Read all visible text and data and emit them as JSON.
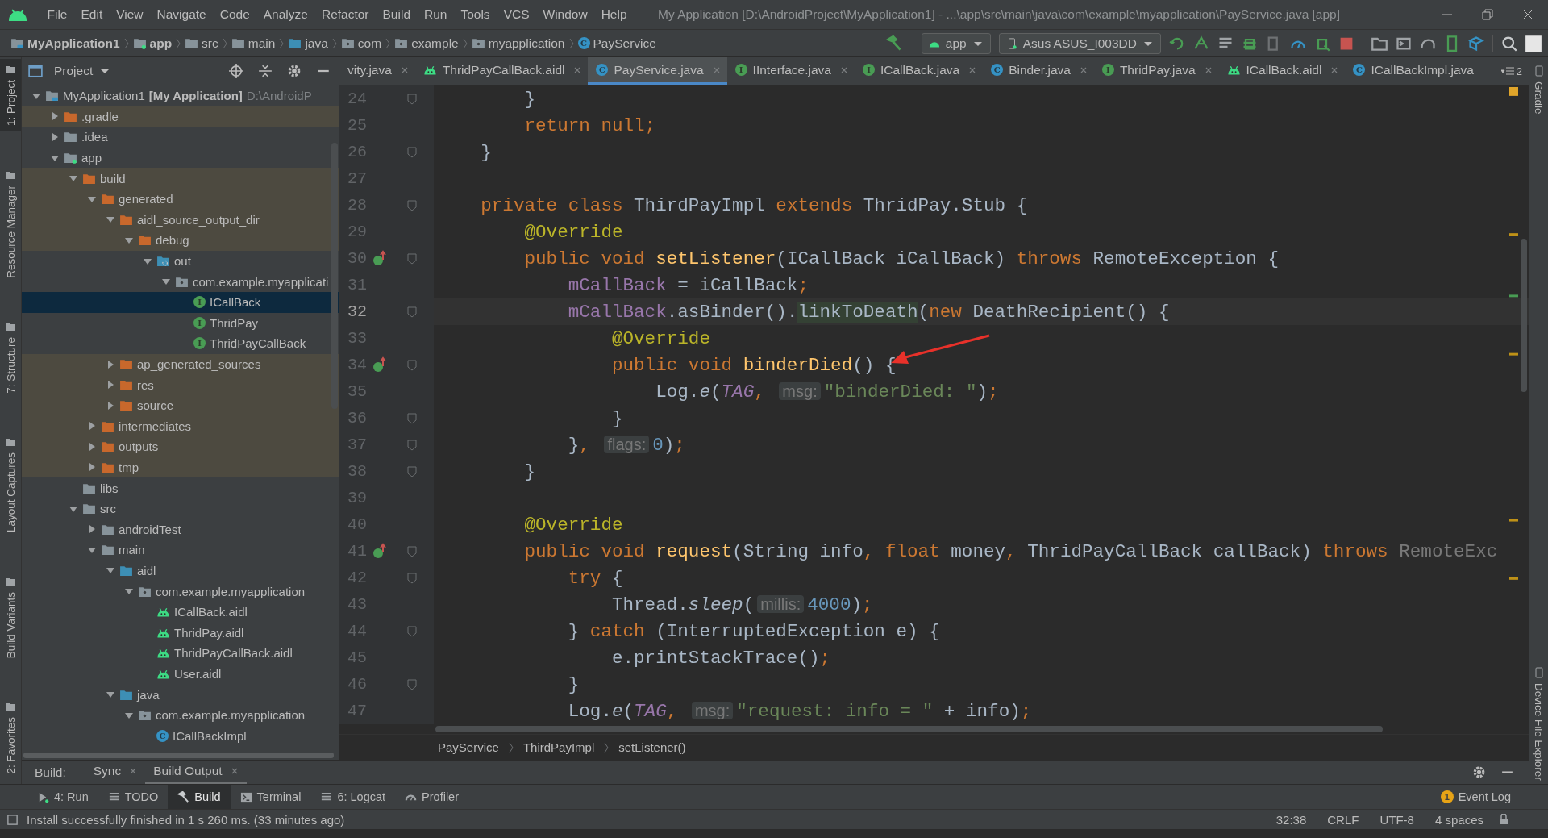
{
  "menu_bar": {
    "items": [
      "File",
      "Edit",
      "View",
      "Navigate",
      "Code",
      "Analyze",
      "Refactor",
      "Build",
      "Run",
      "Tools",
      "VCS",
      "Window",
      "Help"
    ],
    "title": "My Application [D:\\AndroidProject\\MyApplication1] - ...\\app\\src\\main\\java\\com\\example\\myapplication\\PayService.java [app]"
  },
  "navigation_bar": {
    "crumbs": [
      {
        "label": "MyApplication1",
        "kind": "project",
        "bold": true
      },
      {
        "label": "app",
        "kind": "module",
        "bold": true
      },
      {
        "label": "src",
        "kind": "folder",
        "bold": false
      },
      {
        "label": "main",
        "kind": "folder",
        "bold": false
      },
      {
        "label": "java",
        "kind": "folder-source",
        "bold": false
      },
      {
        "label": "com",
        "kind": "package",
        "bold": false
      },
      {
        "label": "example",
        "kind": "package",
        "bold": false
      },
      {
        "label": "myapplication",
        "kind": "package",
        "bold": false
      },
      {
        "label": "PayService",
        "kind": "class",
        "badge": "C",
        "bold": false
      }
    ],
    "run_config": "app",
    "device": "Asus ASUS_I003DD"
  },
  "left_stripe": [
    {
      "label": "1: Project",
      "selected": true
    },
    {
      "label": "Resource Manager",
      "selected": false
    },
    {
      "label": "7: Structure",
      "selected": false
    },
    {
      "label": "Layout Captures",
      "selected": false
    },
    {
      "label": "Build Variants",
      "selected": false
    },
    {
      "label": "2: Favorites",
      "selected": false
    }
  ],
  "project_panel": {
    "title": "Project",
    "tree": [
      {
        "label": "MyApplication1",
        "module": "[My Application]",
        "path": "D:\\AndroidP",
        "kind": "project",
        "expanded": true,
        "excluded": false,
        "selected": false,
        "children": [
          {
            "label": ".gradle",
            "kind": "folder-excluded",
            "expanded": false,
            "excluded": true,
            "selected": false
          },
          {
            "label": ".idea",
            "kind": "folder",
            "expanded": false,
            "excluded": false,
            "selected": false
          },
          {
            "label": "app",
            "kind": "module",
            "expanded": true,
            "excluded": false,
            "selected": false,
            "children": [
              {
                "label": "build",
                "kind": "folder-excluded",
                "expanded": true,
                "excluded": true,
                "selected": false,
                "children": [
                  {
                    "label": "generated",
                    "kind": "folder-excluded",
                    "expanded": true,
                    "excluded": true,
                    "selected": false,
                    "children": [
                      {
                        "label": "aidl_source_output_dir",
                        "kind": "folder-excluded",
                        "expanded": true,
                        "excluded": true,
                        "selected": false,
                        "children": [
                          {
                            "label": "debug",
                            "kind": "folder-excluded",
                            "expanded": true,
                            "excluded": true,
                            "selected": false,
                            "children": [
                              {
                                "label": "out",
                                "kind": "generated",
                                "expanded": true,
                                "excluded": false,
                                "selected": false,
                                "children": [
                                  {
                                    "label": "com.example.myapplicati",
                                    "kind": "package",
                                    "expanded": true,
                                    "excluded": false,
                                    "selected": false,
                                    "children": [
                                      {
                                        "label": "ICallBack",
                                        "kind": "interface",
                                        "badge": "I",
                                        "excluded": false,
                                        "selected": true
                                      },
                                      {
                                        "label": "ThridPay",
                                        "kind": "interface",
                                        "badge": "I",
                                        "excluded": false,
                                        "selected": false
                                      },
                                      {
                                        "label": "ThridPayCallBack",
                                        "kind": "interface",
                                        "badge": "I",
                                        "excluded": false,
                                        "selected": false
                                      }
                                    ]
                                  }
                                ]
                              }
                            ]
                          }
                        ]
                      },
                      {
                        "label": "ap_generated_sources",
                        "kind": "folder-excluded",
                        "expanded": false,
                        "excluded": true,
                        "selected": false
                      },
                      {
                        "label": "res",
                        "kind": "folder-excluded",
                        "expanded": false,
                        "excluded": true,
                        "selected": false
                      },
                      {
                        "label": "source",
                        "kind": "folder-excluded",
                        "expanded": false,
                        "excluded": true,
                        "selected": false
                      }
                    ]
                  },
                  {
                    "label": "intermediates",
                    "kind": "folder-excluded",
                    "expanded": false,
                    "excluded": true,
                    "selected": false
                  },
                  {
                    "label": "outputs",
                    "kind": "folder-excluded",
                    "expanded": false,
                    "excluded": true,
                    "selected": false
                  },
                  {
                    "label": "tmp",
                    "kind": "folder-excluded",
                    "expanded": false,
                    "excluded": true,
                    "selected": false
                  }
                ]
              },
              {
                "label": "libs",
                "kind": "folder",
                "excluded": false,
                "selected": false
              },
              {
                "label": "src",
                "kind": "folder",
                "expanded": true,
                "excluded": false,
                "selected": false,
                "children": [
                  {
                    "label": "androidTest",
                    "kind": "folder",
                    "expanded": false,
                    "excluded": false,
                    "selected": false
                  },
                  {
                    "label": "main",
                    "kind": "folder",
                    "expanded": true,
                    "excluded": false,
                    "selected": false,
                    "children": [
                      {
                        "label": "aidl",
                        "kind": "folder-source",
                        "expanded": true,
                        "excluded": false,
                        "selected": false,
                        "children": [
                          {
                            "label": "com.example.myapplication",
                            "kind": "package",
                            "expanded": true,
                            "excluded": false,
                            "selected": false,
                            "children": [
                              {
                                "label": "ICallBack.aidl",
                                "kind": "aidl",
                                "excluded": false,
                                "selected": false
                              },
                              {
                                "label": "ThridPay.aidl",
                                "kind": "aidl",
                                "excluded": false,
                                "selected": false
                              },
                              {
                                "label": "ThridPayCallBack.aidl",
                                "kind": "aidl",
                                "excluded": false,
                                "selected": false
                              },
                              {
                                "label": "User.aidl",
                                "kind": "aidl",
                                "excluded": false,
                                "selected": false
                              }
                            ]
                          }
                        ]
                      },
                      {
                        "label": "java",
                        "kind": "folder-source",
                        "expanded": true,
                        "excluded": false,
                        "selected": false,
                        "children": [
                          {
                            "label": "com.example.myapplication",
                            "kind": "package",
                            "expanded": true,
                            "excluded": false,
                            "selected": false,
                            "children": [
                              {
                                "label": "ICallBackImpl",
                                "kind": "class",
                                "badge": "C",
                                "excluded": false,
                                "selected": false
                              }
                            ]
                          }
                        ]
                      }
                    ]
                  }
                ]
              }
            ]
          }
        ]
      }
    ]
  },
  "editor_tabs": {
    "tabs": [
      {
        "label": "vity.java",
        "selected": false,
        "closable": true
      },
      {
        "label": "ThridPayCallBack.aidl",
        "kind": "aidl",
        "selected": false,
        "closable": true
      },
      {
        "label": "PayService.java",
        "kind": "class",
        "badge": "C",
        "selected": true,
        "closable": true
      },
      {
        "label": "IInterface.java",
        "kind": "interface",
        "badge": "I",
        "selected": false,
        "closable": true
      },
      {
        "label": "ICallBack.java",
        "kind": "interface",
        "badge": "I",
        "selected": false,
        "closable": true
      },
      {
        "label": "Binder.java",
        "kind": "class",
        "badge": "C",
        "selected": false,
        "closable": true
      },
      {
        "label": "ThridPay.java",
        "kind": "interface",
        "badge": "I",
        "selected": false,
        "closable": true
      },
      {
        "label": "ICallBack.aidl",
        "kind": "aidl",
        "selected": false,
        "closable": true
      },
      {
        "label": "ICallBackImpl.java",
        "kind": "class",
        "badge": "C",
        "selected": false,
        "closable": false
      }
    ],
    "overflow_count": "2"
  },
  "editor": {
    "lines": [
      {
        "number": "24",
        "current": false,
        "fold": true,
        "override": false,
        "tokens": [
          {
            "kind": "plain",
            "text": "        }"
          }
        ]
      },
      {
        "number": "25",
        "current": false,
        "fold": false,
        "override": false,
        "tokens": [
          {
            "kind": "keyword",
            "text": "        return null;"
          }
        ]
      },
      {
        "number": "26",
        "current": false,
        "fold": true,
        "override": false,
        "tokens": [
          {
            "kind": "plain",
            "text": "    }"
          }
        ]
      },
      {
        "number": "27",
        "current": false,
        "fold": false,
        "override": false
      },
      {
        "number": "28",
        "current": false,
        "fold": true,
        "override": false,
        "tokens": [
          {
            "kind": "keyword",
            "text": "    private class"
          },
          {
            "kind": "plain",
            "text": " ThirdPayImpl "
          },
          {
            "kind": "keyword",
            "text": "extends"
          },
          {
            "kind": "plain",
            "text": " ThridPay.Stub {"
          }
        ]
      },
      {
        "number": "29",
        "current": false,
        "fold": false,
        "override": false,
        "tokens": [
          {
            "kind": "annotation",
            "text": "        @Override"
          }
        ]
      },
      {
        "number": "30",
        "current": false,
        "fold": true,
        "override": true,
        "tokens": [
          {
            "kind": "keyword",
            "text": "        public void "
          },
          {
            "kind": "method",
            "text": "setListener"
          },
          {
            "kind": "plain",
            "text": "(ICallBack iCallBack) "
          },
          {
            "kind": "keyword",
            "text": "throws"
          },
          {
            "kind": "plain",
            "text": " RemoteException {"
          }
        ]
      },
      {
        "number": "31",
        "current": false,
        "fold": false,
        "override": false,
        "tokens": [
          {
            "kind": "field",
            "text": "            mCallBack"
          },
          {
            "kind": "plain",
            "text": " = iCallBack"
          },
          {
            "kind": "keyword",
            "text": ";"
          }
        ]
      },
      {
        "number": "32",
        "current": true,
        "fold": true,
        "override": false,
        "tokens": [
          {
            "kind": "field",
            "text": "            mCallBack"
          },
          {
            "kind": "plain",
            "text": ".asBinder()."
          },
          {
            "kind": "highlight",
            "text": "linkToDeath"
          },
          {
            "kind": "plain",
            "text": "("
          },
          {
            "kind": "keyword",
            "text": "new"
          },
          {
            "kind": "plain",
            "text": " DeathRecipient() {"
          }
        ]
      },
      {
        "number": "33",
        "current": false,
        "fold": false,
        "override": false,
        "tokens": [
          {
            "kind": "annotation",
            "text": "                @Override"
          }
        ]
      },
      {
        "number": "34",
        "current": false,
        "fold": true,
        "override": true,
        "tokens": [
          {
            "kind": "keyword",
            "text": "                public void "
          },
          {
            "kind": "method",
            "text": "binderDied"
          },
          {
            "kind": "plain",
            "text": "() {"
          }
        ]
      },
      {
        "number": "35",
        "current": false,
        "fold": false,
        "override": false,
        "tokens": [
          {
            "kind": "plain",
            "text": "                    Log."
          },
          {
            "kind": "italic",
            "text": "e"
          },
          {
            "kind": "plain",
            "text": "("
          },
          {
            "kind": "static",
            "text": "TAG"
          },
          {
            "kind": "keyword",
            "text": ", "
          },
          {
            "kind": "hint",
            "text": "msg:"
          },
          {
            "kind": "string",
            "text": "\"binderDied: \""
          },
          {
            "kind": "plain",
            "text": ")"
          },
          {
            "kind": "keyword",
            "text": ";"
          }
        ]
      },
      {
        "number": "36",
        "current": false,
        "fold": true,
        "override": false,
        "tokens": [
          {
            "kind": "plain",
            "text": "                }"
          }
        ]
      },
      {
        "number": "37",
        "current": false,
        "fold": true,
        "override": false,
        "tokens": [
          {
            "kind": "plain",
            "text": "            }"
          },
          {
            "kind": "keyword",
            "text": ", "
          },
          {
            "kind": "hint",
            "text": "flags:"
          },
          {
            "kind": "number",
            "text": "0"
          },
          {
            "kind": "plain",
            "text": ")"
          },
          {
            "kind": "keyword",
            "text": ";"
          }
        ]
      },
      {
        "number": "38",
        "current": false,
        "fold": true,
        "override": false,
        "tokens": [
          {
            "kind": "plain",
            "text": "        }"
          }
        ]
      },
      {
        "number": "39",
        "current": false,
        "fold": false,
        "override": false
      },
      {
        "number": "40",
        "current": false,
        "fold": false,
        "override": false,
        "tokens": [
          {
            "kind": "annotation",
            "text": "        @Override"
          }
        ]
      },
      {
        "number": "41",
        "current": false,
        "fold": true,
        "override": true,
        "tokens": [
          {
            "kind": "keyword",
            "text": "        public void "
          },
          {
            "kind": "method",
            "text": "request"
          },
          {
            "kind": "plain",
            "text": "(String info"
          },
          {
            "kind": "keyword",
            "text": ", float"
          },
          {
            "kind": "plain",
            "text": " money"
          },
          {
            "kind": "keyword",
            "text": ", "
          },
          {
            "kind": "plain",
            "text": "ThridPayCallBack callBack) "
          },
          {
            "kind": "keyword",
            "text": "throws "
          },
          {
            "kind": "dim",
            "text": "RemoteExc"
          }
        ]
      },
      {
        "number": "42",
        "current": false,
        "fold": true,
        "override": false,
        "tokens": [
          {
            "kind": "keyword",
            "text": "            try"
          },
          {
            "kind": "plain",
            "text": " {"
          }
        ]
      },
      {
        "number": "43",
        "current": false,
        "fold": false,
        "override": false,
        "tokens": [
          {
            "kind": "plain",
            "text": "                Thread."
          },
          {
            "kind": "italic",
            "text": "sleep"
          },
          {
            "kind": "plain",
            "text": "("
          },
          {
            "kind": "hint",
            "text": "millis:"
          },
          {
            "kind": "number",
            "text": "4000"
          },
          {
            "kind": "plain",
            "text": ")"
          },
          {
            "kind": "keyword",
            "text": ";"
          }
        ]
      },
      {
        "number": "44",
        "current": false,
        "fold": true,
        "override": false,
        "tokens": [
          {
            "kind": "plain",
            "text": "            } "
          },
          {
            "kind": "keyword",
            "text": "catch"
          },
          {
            "kind": "plain",
            "text": " (InterruptedException e) {"
          }
        ]
      },
      {
        "number": "45",
        "current": false,
        "fold": false,
        "override": false,
        "tokens": [
          {
            "kind": "plain",
            "text": "                e.printStackTrace()"
          },
          {
            "kind": "keyword",
            "text": ";"
          }
        ]
      },
      {
        "number": "46",
        "current": false,
        "fold": true,
        "override": false,
        "tokens": [
          {
            "kind": "plain",
            "text": "            }"
          }
        ]
      },
      {
        "number": "47",
        "current": false,
        "fold": false,
        "override": false,
        "tokens": [
          {
            "kind": "plain",
            "text": "            Log."
          },
          {
            "kind": "italic",
            "text": "e"
          },
          {
            "kind": "plain",
            "text": "("
          },
          {
            "kind": "static",
            "text": "TAG"
          },
          {
            "kind": "keyword",
            "text": ", "
          },
          {
            "kind": "hint",
            "text": "msg:"
          },
          {
            "kind": "string",
            "text": "\"request: info = \""
          },
          {
            "kind": "plain",
            "text": " + info)"
          },
          {
            "kind": "keyword",
            "text": ";"
          }
        ]
      }
    ],
    "breadcrumb": [
      "PayService",
      "ThirdPayImpl",
      "setListener()"
    ]
  },
  "right_stripe": [
    "Gradle",
    "Device File Explorer"
  ],
  "build_window": {
    "title": "Build:",
    "tabs": [
      {
        "label": "Sync",
        "selected": false
      },
      {
        "label": "Build Output",
        "selected": true
      }
    ]
  },
  "tool_buttons": [
    {
      "label": "4: Run",
      "kind": "run",
      "selected": false
    },
    {
      "label": "TODO",
      "kind": "list",
      "selected": false
    },
    {
      "label": "Build",
      "kind": "hammer",
      "selected": true
    },
    {
      "label": "Terminal",
      "kind": "terminal",
      "selected": false
    },
    {
      "label": "6: Logcat",
      "kind": "list",
      "selected": false
    },
    {
      "label": "Profiler",
      "kind": "gauge",
      "selected": false
    }
  ],
  "event_log": {
    "label": "Event Log",
    "count": "1"
  },
  "status_bar": {
    "message": "Install successfully finished in 1 s 260 ms. (33 minutes ago)",
    "items": [
      "32:38",
      "CRLF",
      "UTF-8",
      "4 spaces"
    ]
  }
}
